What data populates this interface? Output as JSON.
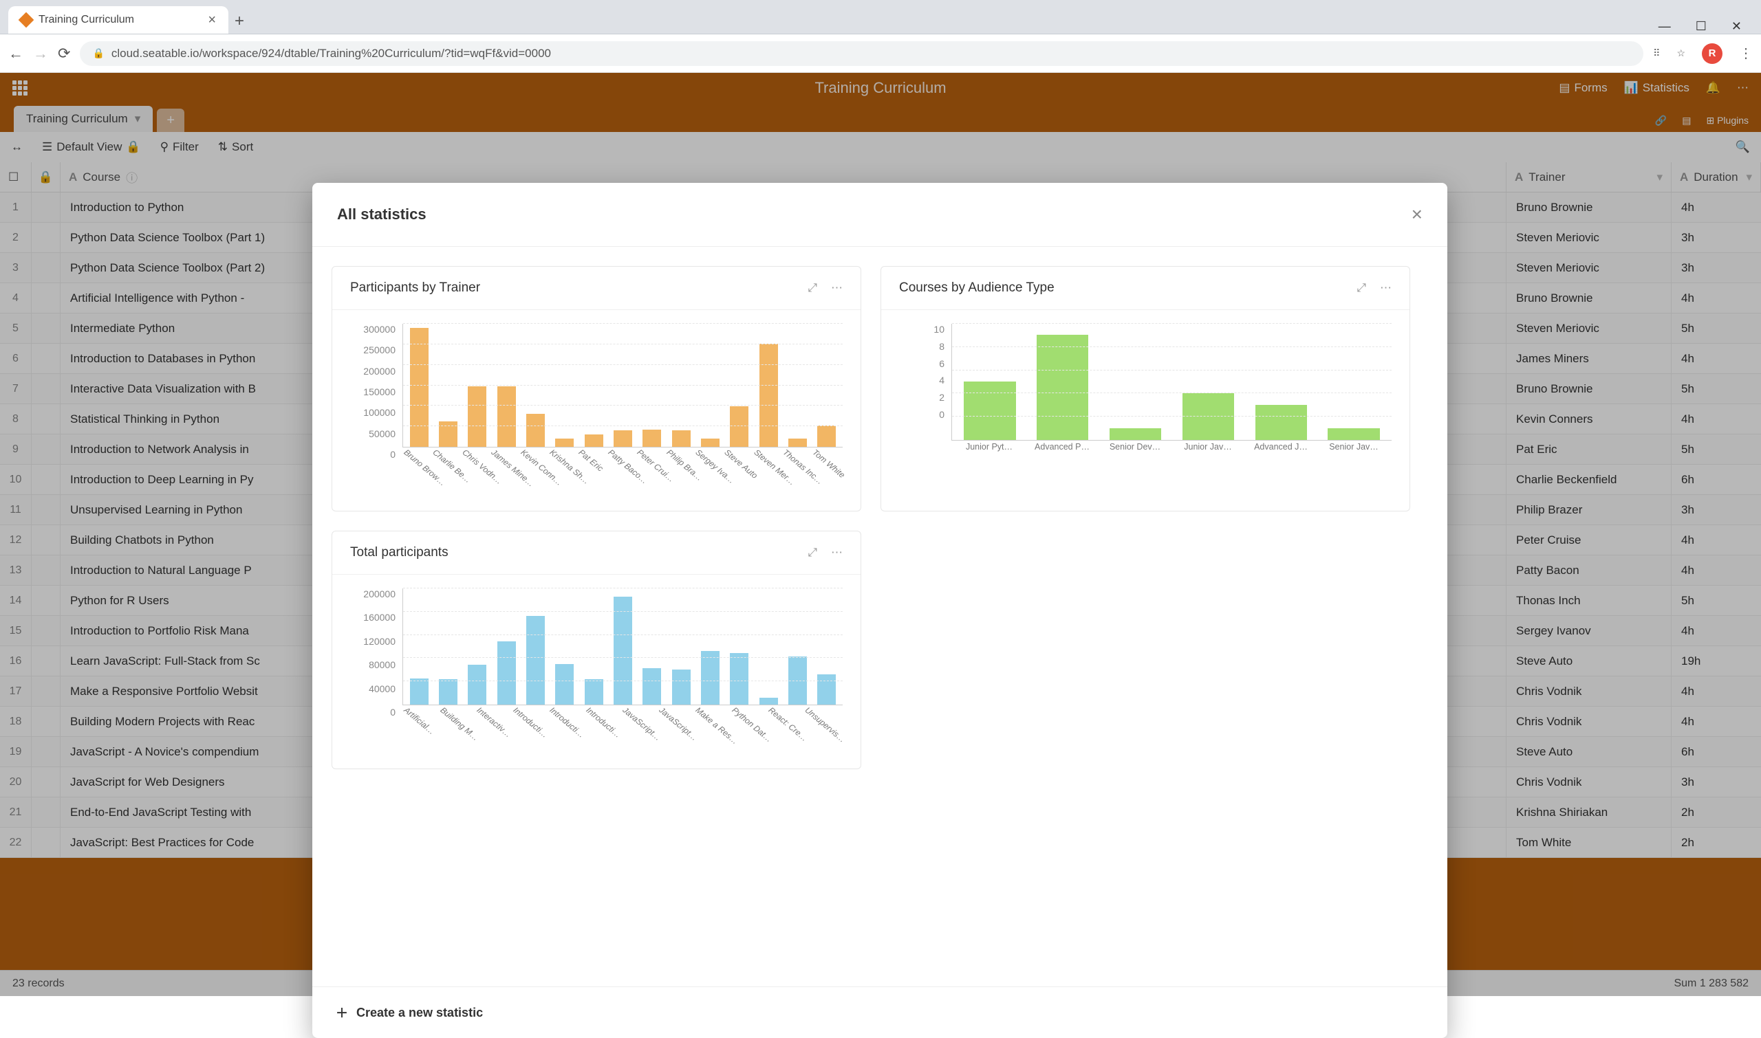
{
  "browser": {
    "tab_title": "Training Curriculum",
    "url": "cloud.seatable.io/workspace/924/dtable/Training%20Curriculum/?tid=wqFf&vid=0000",
    "avatar_letter": "R"
  },
  "app": {
    "title": "Training Curriculum",
    "top_right": {
      "forms": "Forms",
      "statistics": "Statistics"
    },
    "tab_name": "Training Curriculum",
    "view_name": "Default View",
    "toolbar": {
      "filter": "Filter",
      "sort": "Sort",
      "plugins": "Plugins"
    },
    "columns": {
      "course": "Course",
      "trainer": "Trainer",
      "duration": "Duration"
    },
    "rows": [
      {
        "n": 1,
        "course": "Introduction to Python",
        "trainer": "Bruno Brownie",
        "duration": "4h"
      },
      {
        "n": 2,
        "course": "Python Data Science Toolbox (Part 1)",
        "trainer": "Steven Meriovic",
        "duration": "3h"
      },
      {
        "n": 3,
        "course": "Python Data Science Toolbox (Part 2)",
        "trainer": "Steven Meriovic",
        "duration": "3h"
      },
      {
        "n": 4,
        "course": "Artificial Intelligence with Python - ",
        "trainer": "Bruno Brownie",
        "duration": "4h"
      },
      {
        "n": 5,
        "course": "Intermediate Python",
        "trainer": "Steven Meriovic",
        "duration": "5h"
      },
      {
        "n": 6,
        "course": "Introduction to Databases in Python",
        "trainer": "James Miners",
        "duration": "4h"
      },
      {
        "n": 7,
        "course": "Interactive Data Visualization with B",
        "trainer": "Bruno Brownie",
        "duration": "5h"
      },
      {
        "n": 8,
        "course": "Statistical Thinking in Python",
        "trainer": "Kevin Conners",
        "duration": "4h"
      },
      {
        "n": 9,
        "course": "Introduction to Network Analysis in",
        "trainer": "Pat Eric",
        "duration": "5h"
      },
      {
        "n": 10,
        "course": "Introduction to Deep Learning in Py",
        "trainer": "Charlie Beckenfield",
        "duration": "6h"
      },
      {
        "n": 11,
        "course": "Unsupervised Learning in Python",
        "trainer": "Philip Brazer",
        "duration": "3h"
      },
      {
        "n": 12,
        "course": "Building Chatbots in Python",
        "trainer": "Peter Cruise",
        "duration": "4h"
      },
      {
        "n": 13,
        "course": "Introduction to Natural Language P",
        "trainer": "Patty Bacon",
        "duration": "4h"
      },
      {
        "n": 14,
        "course": "Python for R Users",
        "trainer": "Thonas Inch",
        "duration": "5h"
      },
      {
        "n": 15,
        "course": "Introduction to Portfolio Risk Mana",
        "trainer": "Sergey Ivanov",
        "duration": "4h"
      },
      {
        "n": 16,
        "course": "Learn JavaScript: Full-Stack from Sc",
        "trainer": "Steve Auto",
        "duration": "19h"
      },
      {
        "n": 17,
        "course": "Make a Responsive Portfolio Websit",
        "trainer": "Chris Vodnik",
        "duration": "4h"
      },
      {
        "n": 18,
        "course": "Building Modern Projects with Reac",
        "trainer": "Chris Vodnik",
        "duration": "4h"
      },
      {
        "n": 19,
        "course": "JavaScript - A Novice's compendium",
        "trainer": "Steve Auto",
        "duration": "6h"
      },
      {
        "n": 20,
        "course": "JavaScript for Web Designers",
        "trainer": "Chris Vodnik",
        "duration": "3h"
      },
      {
        "n": 21,
        "course": "End-to-End JavaScript Testing with",
        "trainer": "Krishna Shiriakan",
        "duration": "2h"
      },
      {
        "n": 22,
        "course": "JavaScript: Best Practices for Code ",
        "trainer": "Tom White",
        "duration": "2h"
      }
    ],
    "status_left": "23 records",
    "status_right": "Sum 1 283 582"
  },
  "modal": {
    "title": "All statistics",
    "create": "Create a new statistic",
    "card1_title": "Participants by Trainer",
    "card2_title": "Courses by Audience Type",
    "card3_title": "Total participants"
  },
  "chart_data": [
    {
      "type": "bar",
      "title": "Participants by Trainer",
      "ylabel": "",
      "xlabel": "",
      "ylim": [
        0,
        300000
      ],
      "yticks": [
        0,
        50000,
        100000,
        150000,
        200000,
        250000,
        300000
      ],
      "categories": [
        "Bruno Brow…",
        "Charlie Be…",
        "Chris Vodn…",
        "James Mine…",
        "Kevin Conn…",
        "Krishna Sh…",
        "Pat Eric",
        "Patty Baco…",
        "Peter Crui…",
        "Philip Bra…",
        "Sergey Iva…",
        "Steve Auto",
        "Steven Mer…",
        "Thonas Inc…",
        "Tom White"
      ],
      "values": [
        305000,
        65000,
        155000,
        155000,
        85000,
        22000,
        32000,
        42000,
        45000,
        42000,
        22000,
        105000,
        265000,
        22000,
        55000
      ],
      "color": "#f2b664"
    },
    {
      "type": "bar",
      "title": "Courses by Audience Type",
      "ylabel": "",
      "xlabel": "",
      "ylim": [
        0,
        10
      ],
      "yticks": [
        0,
        2,
        4,
        6,
        8,
        10
      ],
      "categories": [
        "Junior Pyt…",
        "Advanced P…",
        "Senior Dev…",
        "Junior Jav…",
        "Advanced J…",
        "Senior Jav…"
      ],
      "values": [
        5,
        9,
        1,
        4,
        3,
        1
      ],
      "color": "#a1dd70"
    },
    {
      "type": "bar",
      "title": "Total participants",
      "ylabel": "",
      "xlabel": "",
      "ylim": [
        0,
        200000
      ],
      "yticks": [
        0,
        40000,
        80000,
        120000,
        160000,
        200000
      ],
      "categories": [
        "Artificial…",
        "Building M…",
        "Interactiv…",
        "Introducti…",
        "Introducti…",
        "Introducti…",
        "JavaScript…",
        "JavaScript…",
        "Make a Res…",
        "Python Dat…",
        "React: Cre…",
        "Unsupervis…"
      ],
      "values": [
        45000,
        44000,
        68000,
        108000,
        152000,
        70000,
        44000,
        185000,
        62000,
        60000,
        92000,
        88000,
        12000,
        82000,
        52000
      ],
      "color": "#92d1ea"
    }
  ]
}
